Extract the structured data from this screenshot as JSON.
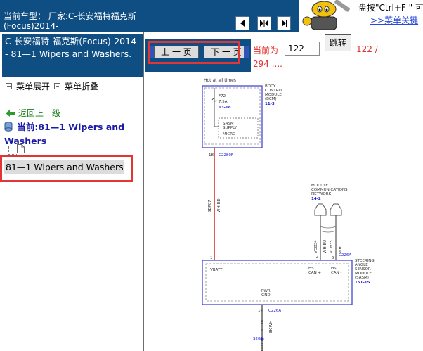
{
  "header": {
    "title_line1": "当前车型：  厂家:C-长安福特福克斯",
    "title_line2": "(Focus)2014-",
    "help_text": "盘按\"Ctrl+F \" 可",
    "help_link": ">>菜单关键"
  },
  "sidebar": {
    "title": "C-长安福特-福克斯(Focus)-2014-- 81—1 Wipers and Washers.",
    "expand_label": "菜单展开",
    "collapse_label": "菜单折叠",
    "back_label": "返回上一级",
    "current_label": "当前:81—1 Wipers and Washers",
    "item_label": "81—1 Wipers and Washers"
  },
  "pager": {
    "prev_label": "上 一 页",
    "next_label": "下 一 页",
    "current_prefix": "当前为",
    "current_page": "122",
    "jump_label": "跳转",
    "total_display": "122 /",
    "total_display2": "294 ...."
  },
  "diagram": {
    "hot_label": "Hot at all times",
    "bcm_label": [
      "BODY",
      "CONTROL",
      "MODULE",
      "(BCM)"
    ],
    "bcm_ref": "11-3",
    "fuse_label": "F72",
    "fuse_rating": "7.5A",
    "fuse_ref": "13-18",
    "sasm_supply": [
      "SASM",
      "SUPPLY"
    ],
    "micro_label": "MICRO",
    "pin_18": "18",
    "conn_c2280f": "C2280F",
    "wire_1": [
      "SBP07",
      "WH-RD"
    ],
    "mod_comm": [
      "MODULE",
      "COMMUNICATIONS",
      "NETWORK"
    ],
    "mod_comm_ref": "14-2",
    "wire_hs_plus": [
      "VDB34",
      "WH-BU"
    ],
    "wire_hs_minus": [
      "VDB35",
      "WH"
    ],
    "pin_1": "1",
    "pin_4": "4",
    "pin_5": "5",
    "conn_c226a": "C226A",
    "sasm_label": [
      "STEERING",
      "ANGLE",
      "SENSOR",
      "MODULE",
      "(SASM)"
    ],
    "sasm_ref": "151-15",
    "vbatt": "VBATT",
    "hs_can_plus": [
      "HS",
      "CAN +"
    ],
    "hs_can_minus": [
      "HS",
      "CAN -"
    ],
    "pwr_gnd": [
      "PWR",
      "GND"
    ],
    "pin_14": "14",
    "conn_c226a_2": "C226A",
    "wire_gnd": [
      "GD138",
      "BK-WH"
    ],
    "splice": "S202",
    "bottom_ref": "GD133"
  },
  "colors": {
    "header_blue": "#0f4e82",
    "highlight_red": "#e23636",
    "page_red": "#e23232",
    "link_green": "#1c7a1c",
    "current_blue": "#1a1aa8"
  }
}
